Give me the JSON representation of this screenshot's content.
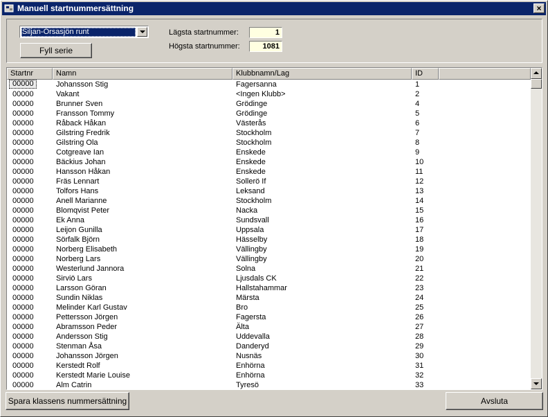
{
  "window": {
    "title": "Manuell startnummersättning",
    "close_label": "×"
  },
  "controls": {
    "class_select_value": "Siljan-Orsasjön runt",
    "fill_series_label": "Fyll serie",
    "lowest_label": "Lägsta startnummer:",
    "lowest_value": "1",
    "highest_label": "Högsta startnummer:",
    "highest_value": "1081"
  },
  "table": {
    "columns": [
      "Startnr",
      "Namn",
      "Klubbnamn/Lag",
      "ID",
      ""
    ],
    "rows": [
      [
        "00000",
        "Johansson Stig",
        "Fagersanna",
        "1"
      ],
      [
        "00000",
        "Vakant",
        "<Ingen Klubb>",
        "2"
      ],
      [
        "00000",
        "Brunner Sven",
        "Grödinge",
        "4"
      ],
      [
        "00000",
        "Fransson Tommy",
        "Grödinge",
        "5"
      ],
      [
        "00000",
        "Råback Håkan",
        "Västerås",
        "6"
      ],
      [
        "00000",
        "Gilstring Fredrik",
        "Stockholm",
        "7"
      ],
      [
        "00000",
        "Gilstring Ola",
        "Stockholm",
        "8"
      ],
      [
        "00000",
        "Cotgreave Ian",
        "Enskede",
        "9"
      ],
      [
        "00000",
        "Bäckius Johan",
        "Enskede",
        "10"
      ],
      [
        "00000",
        "Hansson Håkan",
        "Enskede",
        "11"
      ],
      [
        "00000",
        "Fräs Lennart",
        "Sollerö If",
        "12"
      ],
      [
        "00000",
        "Tolfors Hans",
        "Leksand",
        "13"
      ],
      [
        "00000",
        "Anell Marianne",
        "Stockholm",
        "14"
      ],
      [
        "00000",
        "Blomqvist Peter",
        "Nacka",
        "15"
      ],
      [
        "00000",
        "Ek Anna",
        "Sundsvall",
        "16"
      ],
      [
        "00000",
        "Leijon Gunilla",
        "Uppsala",
        "17"
      ],
      [
        "00000",
        "Sörfalk Björn",
        "Hässelby",
        "18"
      ],
      [
        "00000",
        "Norberg Elisabeth",
        "Vällingby",
        "19"
      ],
      [
        "00000",
        "Norberg Lars",
        "Vällingby",
        "20"
      ],
      [
        "00000",
        "Westerlund Jannora",
        "Solna",
        "21"
      ],
      [
        "00000",
        "Sirviö Lars",
        "Ljusdals CK",
        "22"
      ],
      [
        "00000",
        "Larsson Göran",
        "Hallstahammar",
        "23"
      ],
      [
        "00000",
        "Sundin Niklas",
        "Märsta",
        "24"
      ],
      [
        "00000",
        "Melinder Karl Gustav",
        "Bro",
        "25"
      ],
      [
        "00000",
        "Pettersson Jörgen",
        "Fagersta",
        "26"
      ],
      [
        "00000",
        "Abramsson Peder",
        "Älta",
        "27"
      ],
      [
        "00000",
        "Andersson Stig",
        "Uddevalla",
        "28"
      ],
      [
        "00000",
        "Stenman Åsa",
        "Danderyd",
        "29"
      ],
      [
        "00000",
        "Johansson Jörgen",
        "Nusnäs",
        "30"
      ],
      [
        "00000",
        "Kerstedt Rolf",
        "Enhörna",
        "31"
      ],
      [
        "00000",
        "Kerstedt Marie Louise",
        "Enhörna",
        "32"
      ],
      [
        "00000",
        "Alm Catrin",
        "Tyresö",
        "33"
      ]
    ]
  },
  "footer": {
    "save_label": "Spara klassens nummersättning",
    "exit_label": "Avsluta"
  }
}
